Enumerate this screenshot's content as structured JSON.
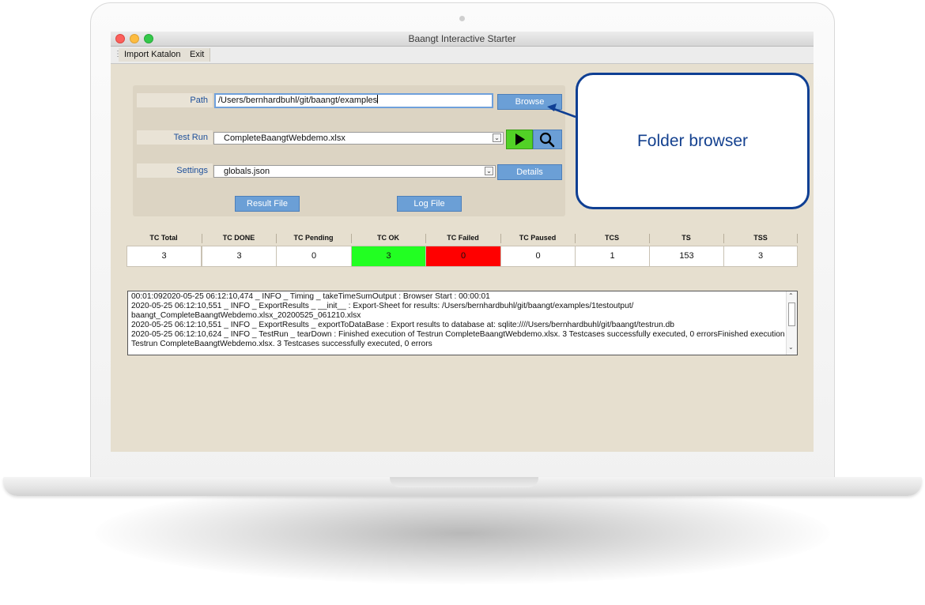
{
  "window": {
    "title": "Baangt Interactive Starter"
  },
  "menu": {
    "items": [
      {
        "label": "Import Katalon"
      },
      {
        "label": "Exit"
      }
    ]
  },
  "form": {
    "path_label": "Path",
    "path_value": "/Users/bernhardbuhl/git/baangt/examples",
    "browse_label": "Browse",
    "testrun_label": "Test Run",
    "testrun_value": "CompleteBaangtWebdemo.xlsx",
    "settings_label": "Settings",
    "settings_value": "globals.json",
    "details_label": "Details",
    "result_file_label": "Result File",
    "log_file_label": "Log File"
  },
  "callout": {
    "text": "Folder browser"
  },
  "stats": {
    "headers": [
      "TC Total",
      "TC DONE",
      "TC Pending",
      "TC OK",
      "TC Failed",
      "TC Paused",
      "TCS",
      "TS",
      "TSS"
    ],
    "values": [
      "3",
      "3",
      "0",
      "3",
      "0",
      "0",
      "1",
      "153",
      "3"
    ],
    "ok_color": "#22ff22",
    "failed_color": "#ff0000"
  },
  "log": {
    "lines": [
      "00:01:092020-05-25 06:12:10,474 _ INFO _ Timing _ takeTimeSumOutput : Browser Start : 00:00:01",
      "2020-05-25 06:12:10,551 _ INFO _ ExportResults _ __init__ : Export-Sheet for results: /Users/bernhardbuhl/git/baangt/examples/1testoutput/",
      "baangt_CompleteBaangtWebdemo.xlsx_20200525_061210.xlsx",
      "2020-05-25 06:12:10,551 _ INFO _ ExportResults _ exportToDataBase : Export results to database at: sqlite:////Users/bernhardbuhl/git/baangt/testrun.db",
      "2020-05-25 06:12:10,624 _ INFO _ TestRun _ tearDown : Finished execution of Testrun CompleteBaangtWebdemo.xlsx. 3 Testcases successfully executed, 0 errorsFinished execution of",
      "Testrun CompleteBaangtWebdemo.xlsx. 3 Testcases successfully executed, 0 errors"
    ]
  }
}
